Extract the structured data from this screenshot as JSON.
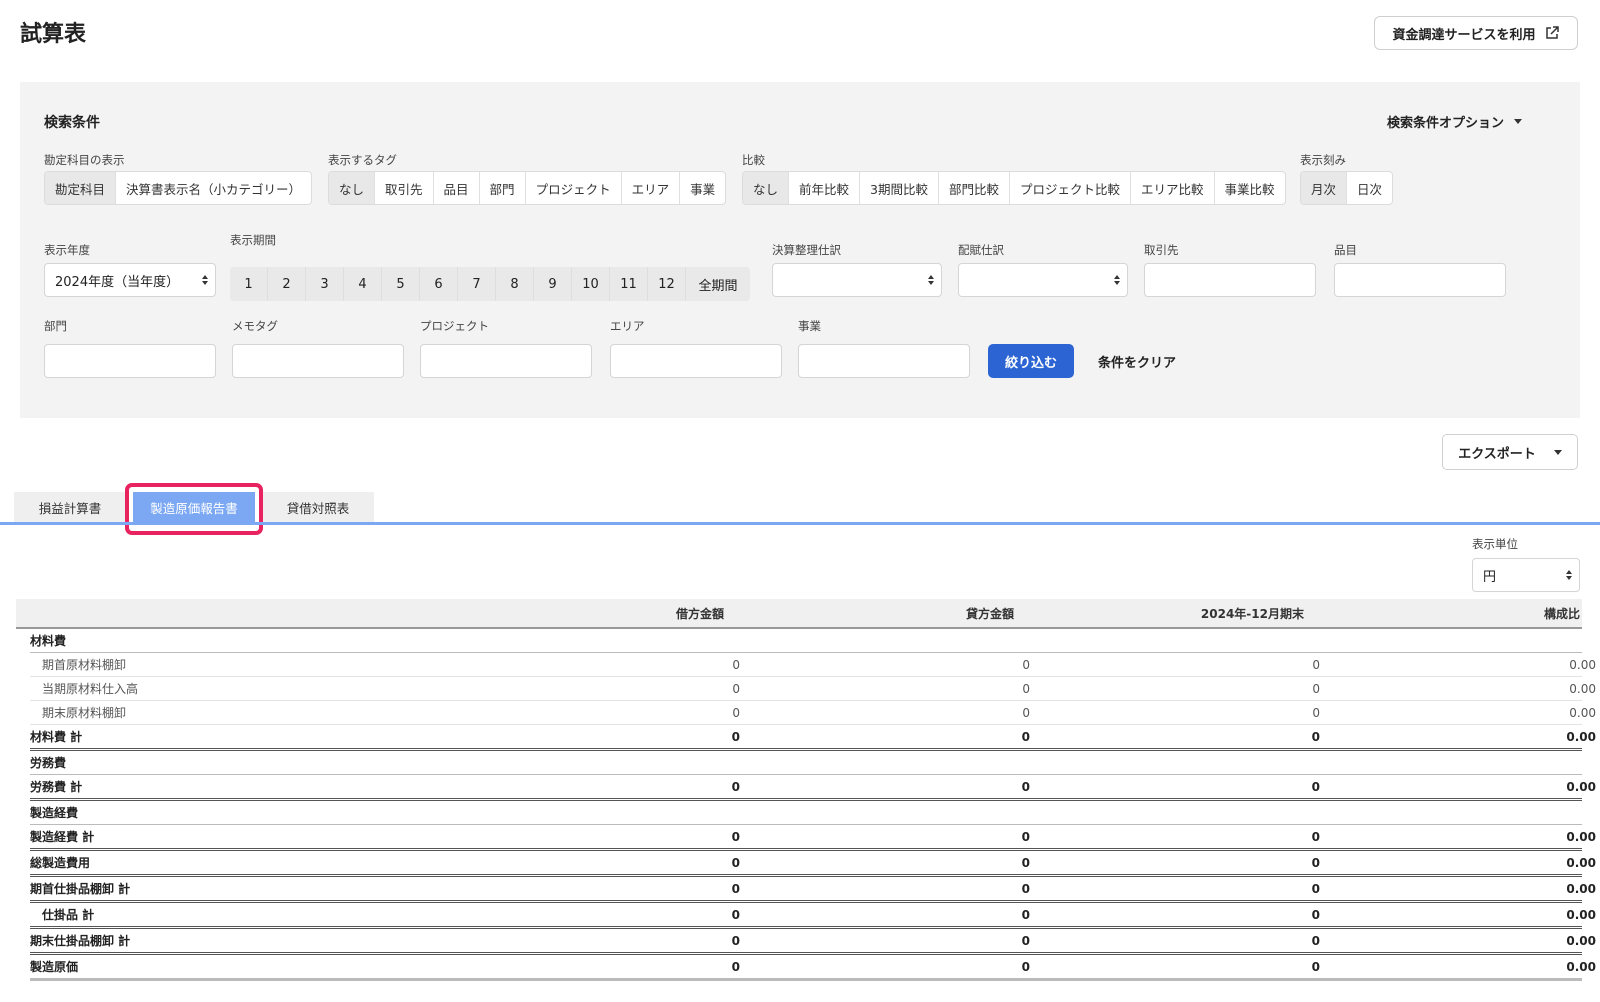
{
  "header": {
    "title": "試算表",
    "funding_button": "資金調達サービスを利用"
  },
  "search": {
    "title": "検索条件",
    "options_label": "検索条件オプション",
    "account_display": {
      "label": "勘定科目の表示",
      "options": [
        "勘定科目",
        "決算書表示名（小カテゴリー）"
      ]
    },
    "tags": {
      "label": "表示するタグ",
      "options": [
        "なし",
        "取引先",
        "品目",
        "部門",
        "プロジェクト",
        "エリア",
        "事業"
      ]
    },
    "compare": {
      "label": "比較",
      "options": [
        "なし",
        "前年比較",
        "3期間比較",
        "部門比較",
        "プロジェクト比較",
        "エリア比較",
        "事業比較"
      ]
    },
    "granularity": {
      "label": "表示刻み",
      "options": [
        "月次",
        "日次"
      ]
    },
    "fiscal_year": {
      "label": "表示年度",
      "value": "2024年度（当年度）"
    },
    "period": {
      "label": "表示期間",
      "options": [
        "1",
        "2",
        "3",
        "4",
        "5",
        "6",
        "7",
        "8",
        "9",
        "10",
        "11",
        "12",
        "全期間"
      ]
    },
    "closing_entry": {
      "label": "決算整理仕訳"
    },
    "allocation_entry": {
      "label": "配賦仕訳"
    },
    "partner": {
      "label": "取引先"
    },
    "item": {
      "label": "品目"
    },
    "department": {
      "label": "部門"
    },
    "memo_tag": {
      "label": "メモタグ"
    },
    "project": {
      "label": "プロジェクト"
    },
    "area": {
      "label": "エリア"
    },
    "business": {
      "label": "事業"
    },
    "filter_button": "絞り込む",
    "clear_link": "条件をクリア"
  },
  "export_button": "エクスポート",
  "tabs": [
    {
      "label": "損益計算書",
      "active": false
    },
    {
      "label": "製造原価報告書",
      "active": true
    },
    {
      "label": "貸借対照表",
      "active": false
    }
  ],
  "unit": {
    "label": "表示単位",
    "value": "円"
  },
  "report": {
    "columns": [
      "",
      "借方金額",
      "貸方金額",
      "2024年-12月期末",
      "構成比"
    ],
    "rows": [
      {
        "type": "section",
        "label": "材料費",
        "values": [
          "",
          "",
          "",
          ""
        ]
      },
      {
        "type": "item",
        "label": "期首原材料棚卸",
        "values": [
          "0",
          "0",
          "0",
          "0.00"
        ]
      },
      {
        "type": "item",
        "label": "当期原材料仕入高",
        "values": [
          "0",
          "0",
          "0",
          "0.00"
        ]
      },
      {
        "type": "item",
        "label": "期末原材料棚卸",
        "values": [
          "0",
          "0",
          "0",
          "0.00"
        ]
      },
      {
        "type": "total",
        "label": "材料費 計",
        "values": [
          "0",
          "0",
          "0",
          "0.00"
        ]
      },
      {
        "type": "section",
        "label": "労務費",
        "values": [
          "",
          "",
          "",
          ""
        ]
      },
      {
        "type": "total",
        "label": "労務費 計",
        "values": [
          "0",
          "0",
          "0",
          "0.00"
        ]
      },
      {
        "type": "section",
        "label": "製造経費",
        "values": [
          "",
          "",
          "",
          ""
        ]
      },
      {
        "type": "total",
        "label": "製造経費 計",
        "values": [
          "0",
          "0",
          "0",
          "0.00"
        ]
      },
      {
        "type": "total",
        "label": "総製造費用",
        "values": [
          "0",
          "0",
          "0",
          "0.00"
        ]
      },
      {
        "type": "total",
        "label": "期首仕掛品棚卸 計",
        "values": [
          "0",
          "0",
          "0",
          "0.00"
        ]
      },
      {
        "type": "total sub",
        "label": "仕掛品 計",
        "values": [
          "0",
          "0",
          "0",
          "0.00"
        ]
      },
      {
        "type": "total",
        "label": "期末仕掛品棚卸 計",
        "values": [
          "0",
          "0",
          "0",
          "0.00"
        ]
      },
      {
        "type": "total final",
        "label": "製造原価",
        "values": [
          "0",
          "0",
          "0",
          "0.00"
        ]
      }
    ]
  },
  "colors": {
    "primary": "#2c65d3",
    "tab_active": "#7ca8f3",
    "highlight": "#e8235f"
  }
}
